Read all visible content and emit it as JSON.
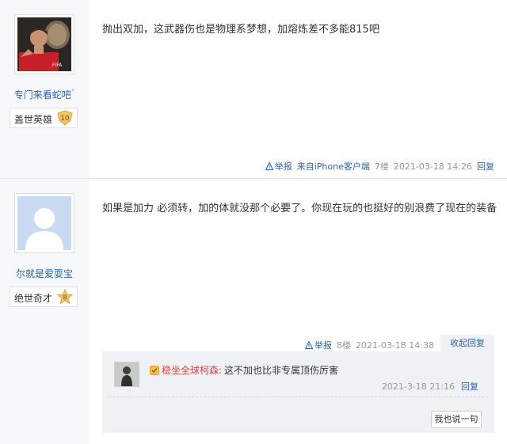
{
  "posts": [
    {
      "username": "专门来看蛇吧",
      "username_suffix": "°",
      "badge_title": "盖世英雄",
      "badge_level": "10",
      "content": "抛出双加，这武器伤也是物理系梦想，加熔炼差不多能815吧",
      "report_label": "举报",
      "client": "来自iPhone客户端",
      "floor": "7楼",
      "time": "2021-03-18 14:26",
      "reply_label": "回复",
      "avatar_caption": "FIFA"
    },
    {
      "username": "尔就是爱耍宝",
      "badge_title": "绝世奇才",
      "badge_level": "8",
      "content": "如果是加力 必须转，加的体就没那个必要了。你现在玩的也挺好的别浪费了现在的装备",
      "report_label": "举报",
      "floor": "8楼",
      "time": "2021-03-18 14:38",
      "fold_label": "收起回复",
      "sub_reply": {
        "author": "稳坐全球柯森:",
        "text": "这不加也比非专属顶伤厉害",
        "time": "2021-3-18 21:16",
        "reply_label": "回复"
      },
      "say_button": "我也说一句"
    }
  ],
  "colors": {
    "link": "#2d64b3",
    "sidebar": "#f7f8fa",
    "subreply_bg": "#f0f1f4",
    "level_badge": "#f2c66d"
  }
}
